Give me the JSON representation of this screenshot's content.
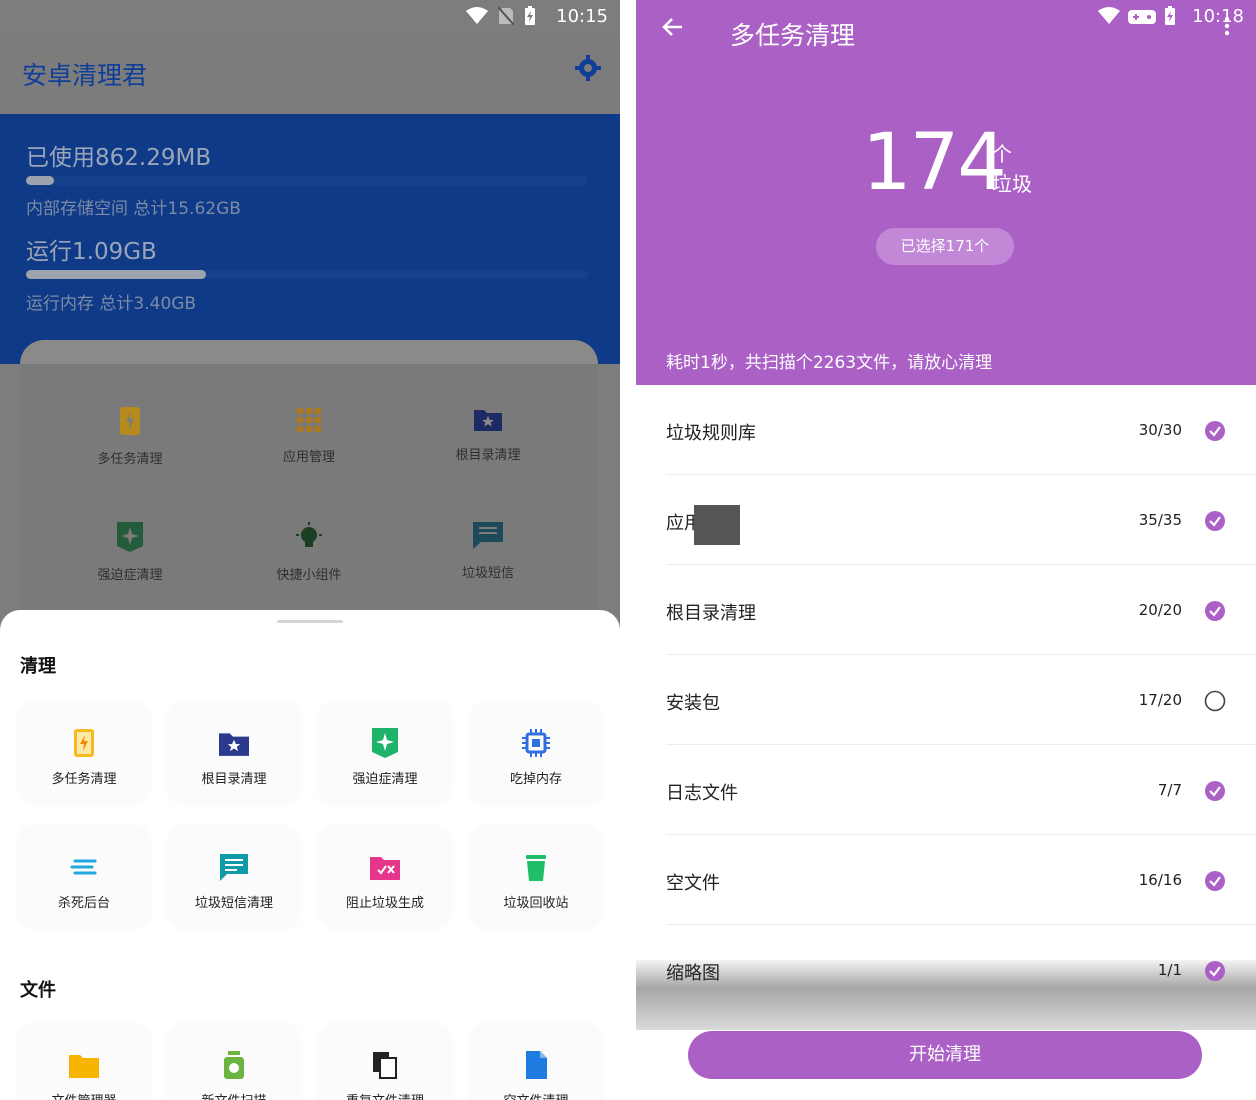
{
  "left": {
    "status": {
      "time": "10:15"
    },
    "app_title": "安卓清理君",
    "storage": {
      "used_label": "已使用862.29MB",
      "used_fraction": 0.05,
      "internal_label": "内部存储空间 总计15.62GB",
      "running_label": "运行1.09GB",
      "running_fraction": 0.32,
      "ram_label": "运行内存 总计3.40GB"
    },
    "dim_grid": [
      {
        "icon": "phone-bolt-icon",
        "label": "多任务清理"
      },
      {
        "icon": "apps-grid-icon",
        "label": "应用管理"
      },
      {
        "icon": "folder-star-icon",
        "label": "根目录清理"
      },
      {
        "icon": "sparkle-badge-icon",
        "label": "强迫症清理"
      },
      {
        "icon": "bulb-widget-icon",
        "label": "快捷小组件"
      },
      {
        "icon": "message-icon",
        "label": "垃圾短信"
      }
    ],
    "sheet": {
      "section_clean": "清理",
      "clean_tiles": [
        {
          "icon": "phone-bolt-icon",
          "label": "多任务清理"
        },
        {
          "icon": "folder-star-icon",
          "label": "根目录清理"
        },
        {
          "icon": "sparkle-badge-icon",
          "label": "强迫症清理"
        },
        {
          "icon": "chip-icon",
          "label": "吃掉内存"
        },
        {
          "icon": "lines-icon",
          "label": "杀死后台"
        },
        {
          "icon": "message-icon",
          "label": "垃圾短信清理"
        },
        {
          "icon": "folder-block-icon",
          "label": "阻止垃圾生成"
        },
        {
          "icon": "trash-icon",
          "label": "垃圾回收站"
        }
      ],
      "section_files": "文件",
      "file_tiles": [
        {
          "icon": "folder-icon",
          "label": "文件管理器"
        },
        {
          "icon": "jar-icon",
          "label": "新文件扫描"
        },
        {
          "icon": "duplicate-file-icon",
          "label": "重复文件清理"
        },
        {
          "icon": "file-icon",
          "label": "空文件清理"
        }
      ]
    }
  },
  "right": {
    "status": {
      "time": "10:18"
    },
    "title": "多任务清理",
    "count": "174",
    "unit_top": "个",
    "unit_bottom": "垃圾",
    "selected_pill": "已选择171个",
    "note": "耗时1秒，共扫描个2263文件，请放心清理",
    "rows": [
      {
        "name": "垃圾规则库",
        "count": "30/30",
        "checked": true
      },
      {
        "name": "应用缓存",
        "count": "35/35",
        "checked": true
      },
      {
        "name": "根目录清理",
        "count": "20/20",
        "checked": true
      },
      {
        "name": "安装包",
        "count": "17/20",
        "checked": false
      },
      {
        "name": "日志文件",
        "count": "7/7",
        "checked": true
      },
      {
        "name": "空文件",
        "count": "16/16",
        "checked": true
      },
      {
        "name": "缩略图",
        "count": "1/1",
        "checked": true
      }
    ],
    "cta": "开始清理",
    "accent": "#ab60c6"
  }
}
